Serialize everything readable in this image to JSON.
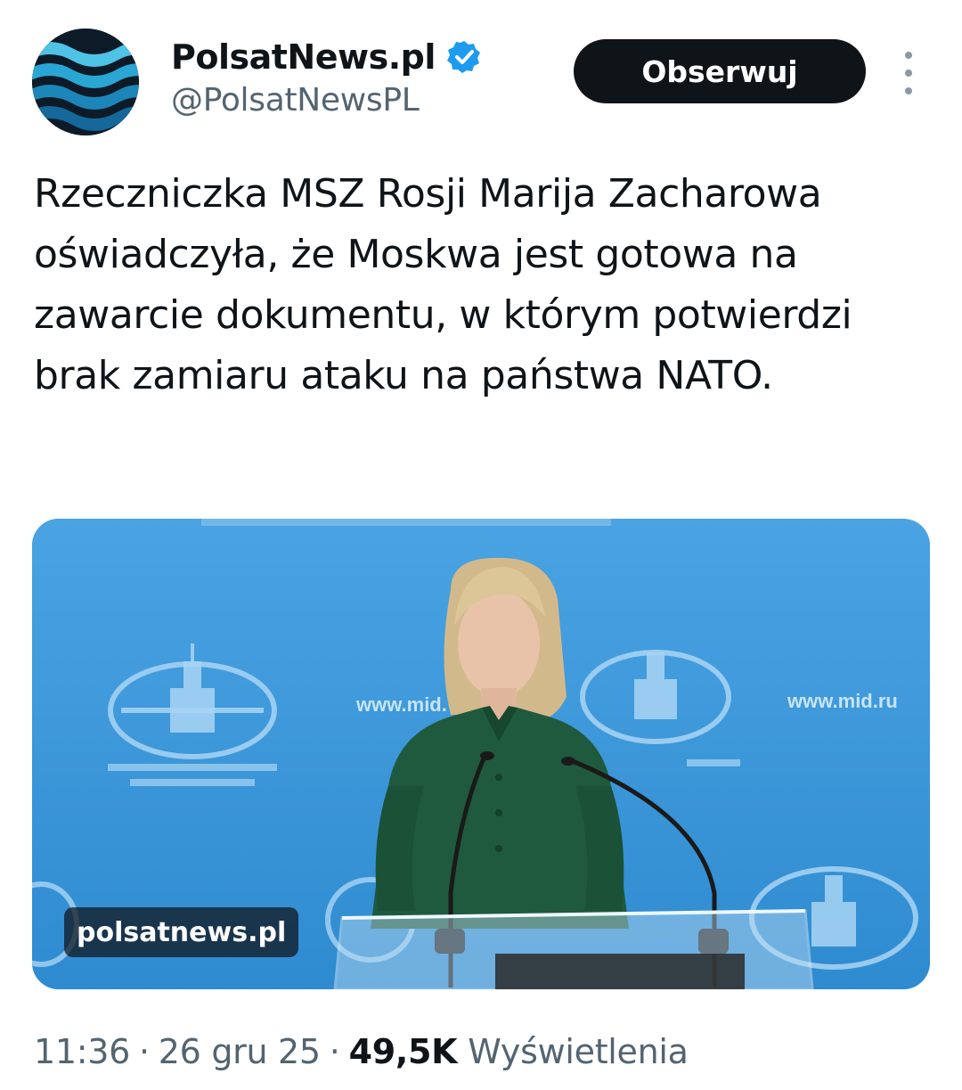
{
  "author": {
    "display_name": "PolsatNews.pl",
    "handle": "@PolsatNewsPL",
    "verified": true,
    "avatar_icon": "polsatnews-wave-logo",
    "verified_icon": "verified-badge-icon"
  },
  "actions": {
    "follow_label": "Obserwuj",
    "more_icon": "more-vertical-icon"
  },
  "tweet": {
    "text": "Rzeczniczka MSZ Rosji Marija Zacharowa oświadczyła, że Moskwa jest gotowa na zawarcie dokumentu, w którym potwierdzi brak zamiaru ataku na państwa NATO."
  },
  "media": {
    "source_label": "polsatnews.pl",
    "backdrop_text_left": "www.mid.",
    "backdrop_text_right": "www.mid.ru"
  },
  "meta": {
    "time": "11:36",
    "separator": "·",
    "date": "26 gru 25",
    "views_count": "49,5K",
    "views_label": "Wyświetlenia"
  },
  "colors": {
    "follow_button_bg": "#0f1419",
    "verified_badge": "#1d9bf0",
    "secondary_text": "#536471",
    "media_backdrop": "#3b94d8"
  }
}
